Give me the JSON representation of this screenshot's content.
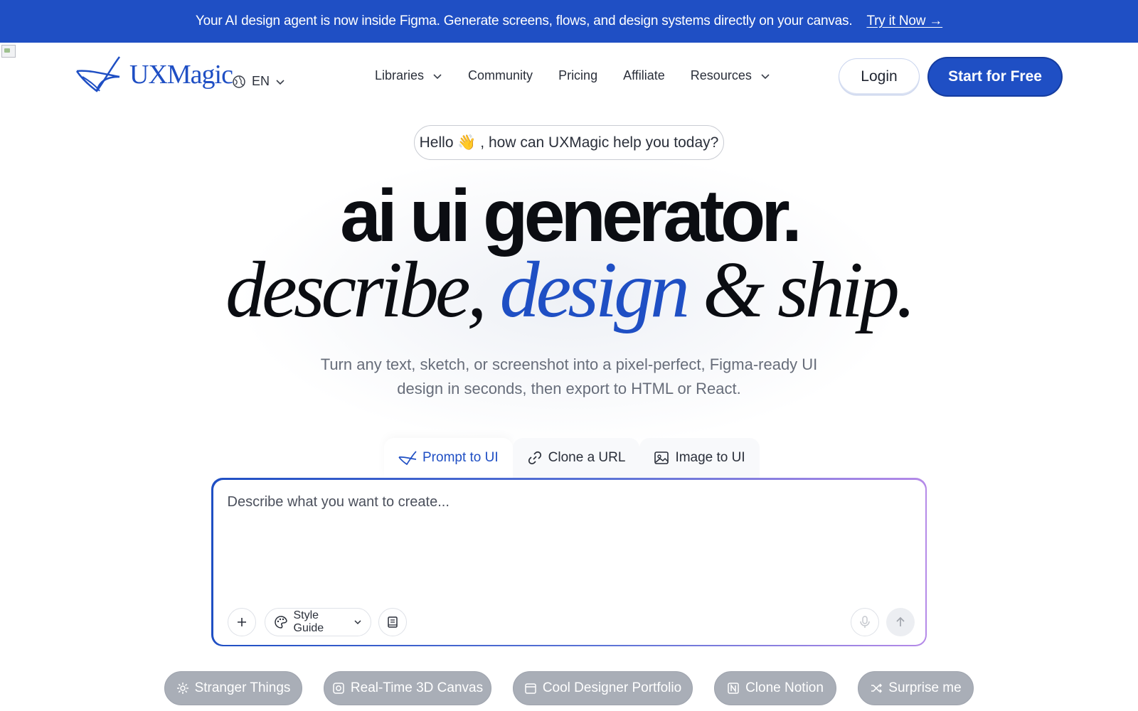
{
  "banner": {
    "text": "Your AI design agent is now inside Figma. Generate screens, flows, and design systems directly on your canvas.",
    "cta": "Try it Now →"
  },
  "nav": {
    "logo_text": "UXMagic",
    "language": "EN",
    "links": [
      {
        "label": "Libraries",
        "has_dropdown": true
      },
      {
        "label": "Community",
        "has_dropdown": false
      },
      {
        "label": "Pricing",
        "has_dropdown": false
      },
      {
        "label": "Affiliate",
        "has_dropdown": false
      },
      {
        "label": "Resources",
        "has_dropdown": true
      }
    ],
    "login_label": "Login",
    "start_label": "Start for Free"
  },
  "hero": {
    "greeting": "Hello 👋 , how can UXMagic help you today?",
    "headline": "ai ui generator.",
    "tagline_part1": "describe, ",
    "tagline_accent": "design",
    "tagline_part2": " & ship.",
    "subtitle_line1": "Turn any text, sketch, or screenshot into a pixel-perfect, Figma-ready UI",
    "subtitle_line2": "design in seconds, then export to HTML or React."
  },
  "tabs": [
    {
      "label": "Prompt to UI",
      "active": true,
      "icon": "paper-plane-icon"
    },
    {
      "label": "Clone a URL",
      "active": false,
      "icon": "link-icon"
    },
    {
      "label": "Image to UI",
      "active": false,
      "icon": "image-icon"
    }
  ],
  "prompt": {
    "placeholder": "Describe what you want to create...",
    "value": "",
    "style_guide_label": "Style Guide"
  },
  "suggestions": [
    {
      "label": "Stranger Things",
      "icon": "gear-icon"
    },
    {
      "label": "Real-Time 3D Canvas",
      "icon": "camera-icon"
    },
    {
      "label": "Cool Designer Portfolio",
      "icon": "calendar-icon"
    },
    {
      "label": "Clone Notion",
      "icon": "notion-icon"
    },
    {
      "label": "Surprise me",
      "icon": "shuffle-icon"
    }
  ],
  "colors": {
    "brand_blue": "#1f4fc4",
    "gradient_end": "#b58ae8",
    "chip_gray": "#a9aeb7"
  }
}
